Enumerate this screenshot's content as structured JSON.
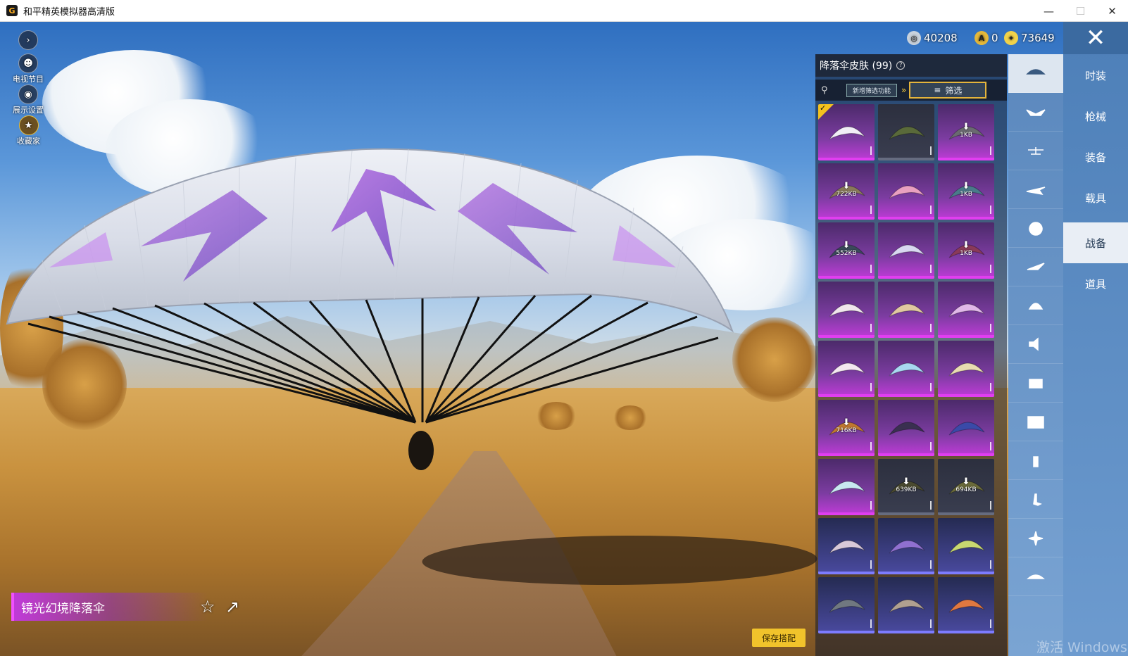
{
  "window": {
    "title": "和平精英模拟器高清版",
    "icon": "app-logo-icon",
    "controls": [
      "minimize",
      "maximize",
      "close"
    ]
  },
  "left_panel": {
    "toggle_icon": "chevron-right-icon",
    "items": [
      {
        "label": "电视节目",
        "icon": "person-icon"
      },
      {
        "label": "展示设置",
        "icon": "eye-icon"
      },
      {
        "label": "收藏家",
        "icon": "medal-icon"
      }
    ]
  },
  "currency": [
    {
      "value": "40208",
      "icon": "silver-coin-icon",
      "color": "#c9d2dc"
    },
    {
      "value": "0",
      "icon": "gold-a-coin-icon",
      "color": "#e5b83a"
    },
    {
      "value": "73649",
      "icon": "gold-coin-icon",
      "color": "#f1d24a"
    }
  ],
  "panel": {
    "title": "降落伞皮肤 (99)",
    "new_filter_label": "新增筛选功能",
    "filter_label": "筛选",
    "tiles": [
      {
        "style": "purple",
        "canopy": "#f1eef6",
        "download": null,
        "equipped": true
      },
      {
        "style": "dark",
        "canopy": "#5a6a3a",
        "download": null
      },
      {
        "style": "purple",
        "canopy": "#6a6a70",
        "download": "1KB"
      },
      {
        "style": "purple",
        "canopy": "#8a7a5a",
        "download": "722KB"
      },
      {
        "style": "purple",
        "canopy": "#e9a0c0",
        "download": null
      },
      {
        "style": "purple",
        "canopy": "#4a7a8a",
        "download": "1KB"
      },
      {
        "style": "purple",
        "canopy": "#3a4a5a",
        "download": "552KB"
      },
      {
        "style": "purple",
        "canopy": "#d8d8f0",
        "download": null
      },
      {
        "style": "purple",
        "canopy": "#8a3a5a",
        "download": "1KB"
      },
      {
        "style": "purple",
        "canopy": "#f0e6ec",
        "download": null
      },
      {
        "style": "purple",
        "canopy": "#e0c8a0",
        "download": null
      },
      {
        "style": "purple",
        "canopy": "#e0b8e8",
        "download": null
      },
      {
        "style": "purple",
        "canopy": "#f4e8f0",
        "download": null
      },
      {
        "style": "purple",
        "canopy": "#a8d8f0",
        "download": null
      },
      {
        "style": "purple",
        "canopy": "#e8dcb0",
        "download": null
      },
      {
        "style": "purple",
        "canopy": "#c07830",
        "download": "716KB"
      },
      {
        "style": "purple",
        "canopy": "#3a3050",
        "download": null
      },
      {
        "style": "purple",
        "canopy": "#3a4aa8",
        "download": null
      },
      {
        "style": "purple",
        "canopy": "#c8e8f0",
        "download": null
      },
      {
        "style": "dark",
        "canopy": "#4a4a30",
        "download": "639KB"
      },
      {
        "style": "dark",
        "canopy": "#6a6a3a",
        "download": "694KB"
      },
      {
        "style": "violet",
        "canopy": "#d8c8d8",
        "download": null
      },
      {
        "style": "violet",
        "canopy": "#9070d0",
        "download": null
      },
      {
        "style": "violet",
        "canopy": "#c8d870",
        "download": null
      },
      {
        "style": "violet",
        "canopy": "#707880",
        "download": null
      },
      {
        "style": "violet",
        "canopy": "#b0a090",
        "download": null
      },
      {
        "style": "violet",
        "canopy": "#e07840",
        "download": null
      }
    ]
  },
  "category_icons": [
    "parachute-icon",
    "wings-icon",
    "drone-icon",
    "plane-icon",
    "face-icon",
    "glider-icon",
    "helmet-icon",
    "sound-icon",
    "mascot-icon",
    "image-icon",
    "spray-icon",
    "tap-icon",
    "sparkle-icon",
    "dish-icon"
  ],
  "tabs": [
    "时装",
    "枪械",
    "装备",
    "载具",
    "战备",
    "道具"
  ],
  "active_tab": "战备",
  "selected_item": {
    "name": "镜光幻境降落伞"
  },
  "actions": {
    "save_label": "保存搭配",
    "favorite_icon": "star-icon",
    "share_icon": "share-icon"
  },
  "watermark": "激活 Windows"
}
